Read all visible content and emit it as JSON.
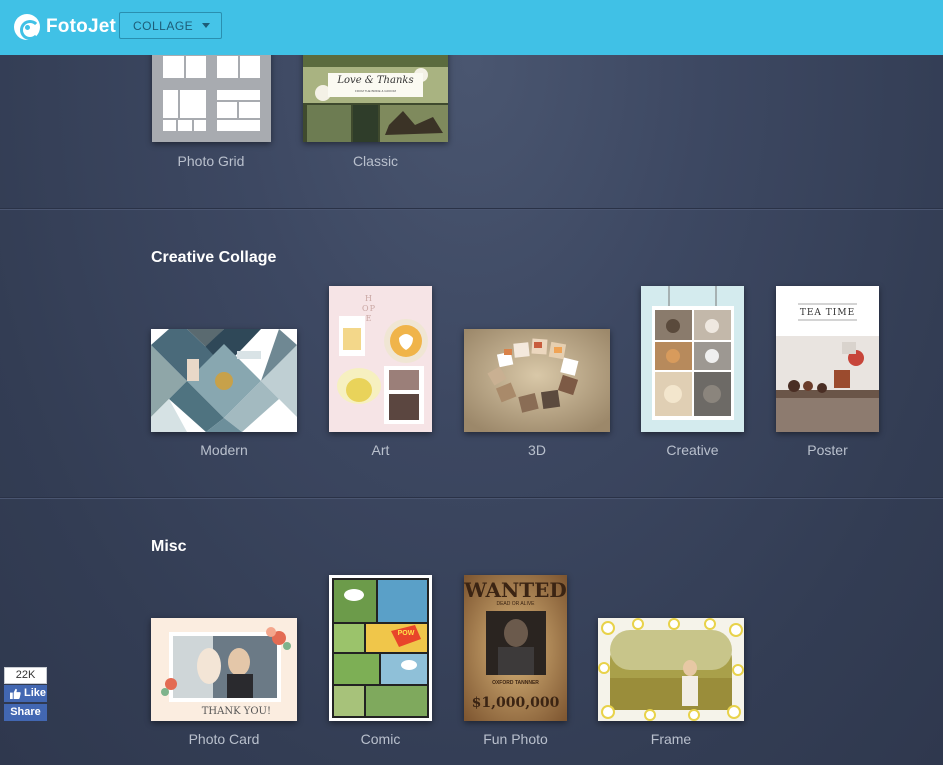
{
  "header": {
    "brand": "FotoJet",
    "menu_label": "COLLAGE"
  },
  "sections": {
    "basic": {
      "items": [
        {
          "label": "Photo Grid"
        },
        {
          "label": "Classic",
          "thumb_text": "Love & Thanks",
          "thumb_subtext": "FROM THE BRIDE & GROOM"
        }
      ]
    },
    "creative": {
      "title": "Creative Collage",
      "items": [
        {
          "label": "Modern"
        },
        {
          "label": "Art",
          "thumb_text": "HOPE"
        },
        {
          "label": "3D"
        },
        {
          "label": "Creative"
        },
        {
          "label": "Poster",
          "thumb_text": "TEA TIME"
        }
      ]
    },
    "misc": {
      "title": "Misc",
      "items": [
        {
          "label": "Photo Card",
          "thumb_text": "THANK YOU!"
        },
        {
          "label": "Comic",
          "thumb_text": "POW"
        },
        {
          "label": "Fun Photo",
          "thumb_text": "WANTED",
          "thumb_subtext": "DEAD OR ALIVE",
          "thumb_name": "OXFORD TANNNER",
          "thumb_reward": "$1,000,000"
        },
        {
          "label": "Frame"
        }
      ]
    }
  },
  "social": {
    "like_count": "22K",
    "like_label": "Like",
    "share_label": "Share"
  },
  "colors": {
    "header_bg": "#40c1e6",
    "page_bg": "#3a4560",
    "label_text": "#b9c0cd"
  }
}
